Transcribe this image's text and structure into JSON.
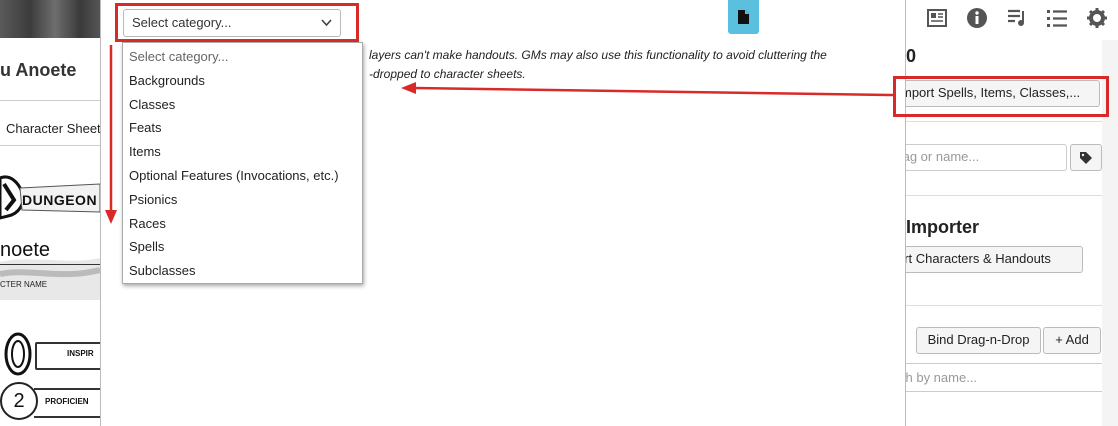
{
  "character": {
    "title": "u Anoete",
    "tab_label": "Character Sheet",
    "logo_text": "DUNGEON",
    "name_value": "noete",
    "name_label": "CTER NAME",
    "inspiration_label": "INSPIR",
    "proficiency_value": "2",
    "proficiency_label": "PROFICIEN"
  },
  "dialog": {
    "category_select": {
      "selected": "Select category...",
      "options": [
        "Select category...",
        "Backgrounds",
        "Classes",
        "Feats",
        "Items",
        "Optional Features (Invocations, etc.)",
        "Psionics",
        "Races",
        "Spells",
        "Subclasses"
      ]
    },
    "handout_icon": "file-icon",
    "description_line1": "layers can't make handouts. GMs may also use this functionality to avoid cluttering the",
    "description_line2": "-dropped to character sheets."
  },
  "sidebar": {
    "toolbar_icons": [
      "newspaper-icon",
      "info-icon",
      "music-list-icon",
      "list-icon",
      "gear-icon"
    ],
    "counter": "0",
    "import_button": "mport Spells, Items, Classes,...",
    "tag_search_placeholder": "tag or name...",
    "tag_icon": "tag-icon",
    "importer_heading": "Importer",
    "import_characters_button": "ort Characters & Handouts",
    "bind_button": "Bind Drag-n-Drop",
    "add_button": "+ Add",
    "search_placeholder": "ch by name..."
  },
  "annotation_color": "#d92a2a",
  "accent_color": "#5bc0de"
}
